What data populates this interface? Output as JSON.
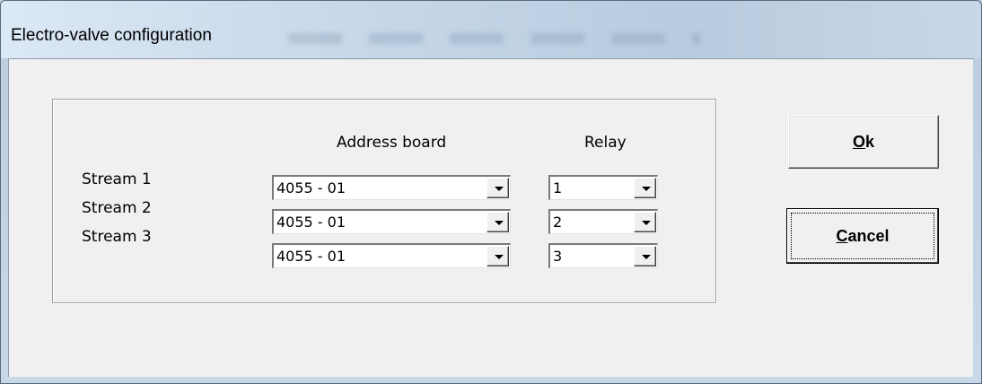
{
  "window": {
    "title": "Electro-valve configuration"
  },
  "headers": {
    "address_board": "Address board",
    "relay": "Relay"
  },
  "streams": [
    {
      "label": "Stream 1",
      "address_board": "4055 - 01",
      "relay": "1"
    },
    {
      "label": "Stream 2",
      "address_board": "4055 - 01",
      "relay": "2"
    },
    {
      "label": "Stream 3",
      "address_board": "4055 - 01",
      "relay": "3"
    }
  ],
  "buttons": {
    "ok": {
      "mnemonic": "O",
      "rest": "k"
    },
    "cancel": {
      "mnemonic": "C",
      "rest": "ancel"
    }
  },
  "icons": {
    "dropdown": "chevron-down-icon"
  }
}
